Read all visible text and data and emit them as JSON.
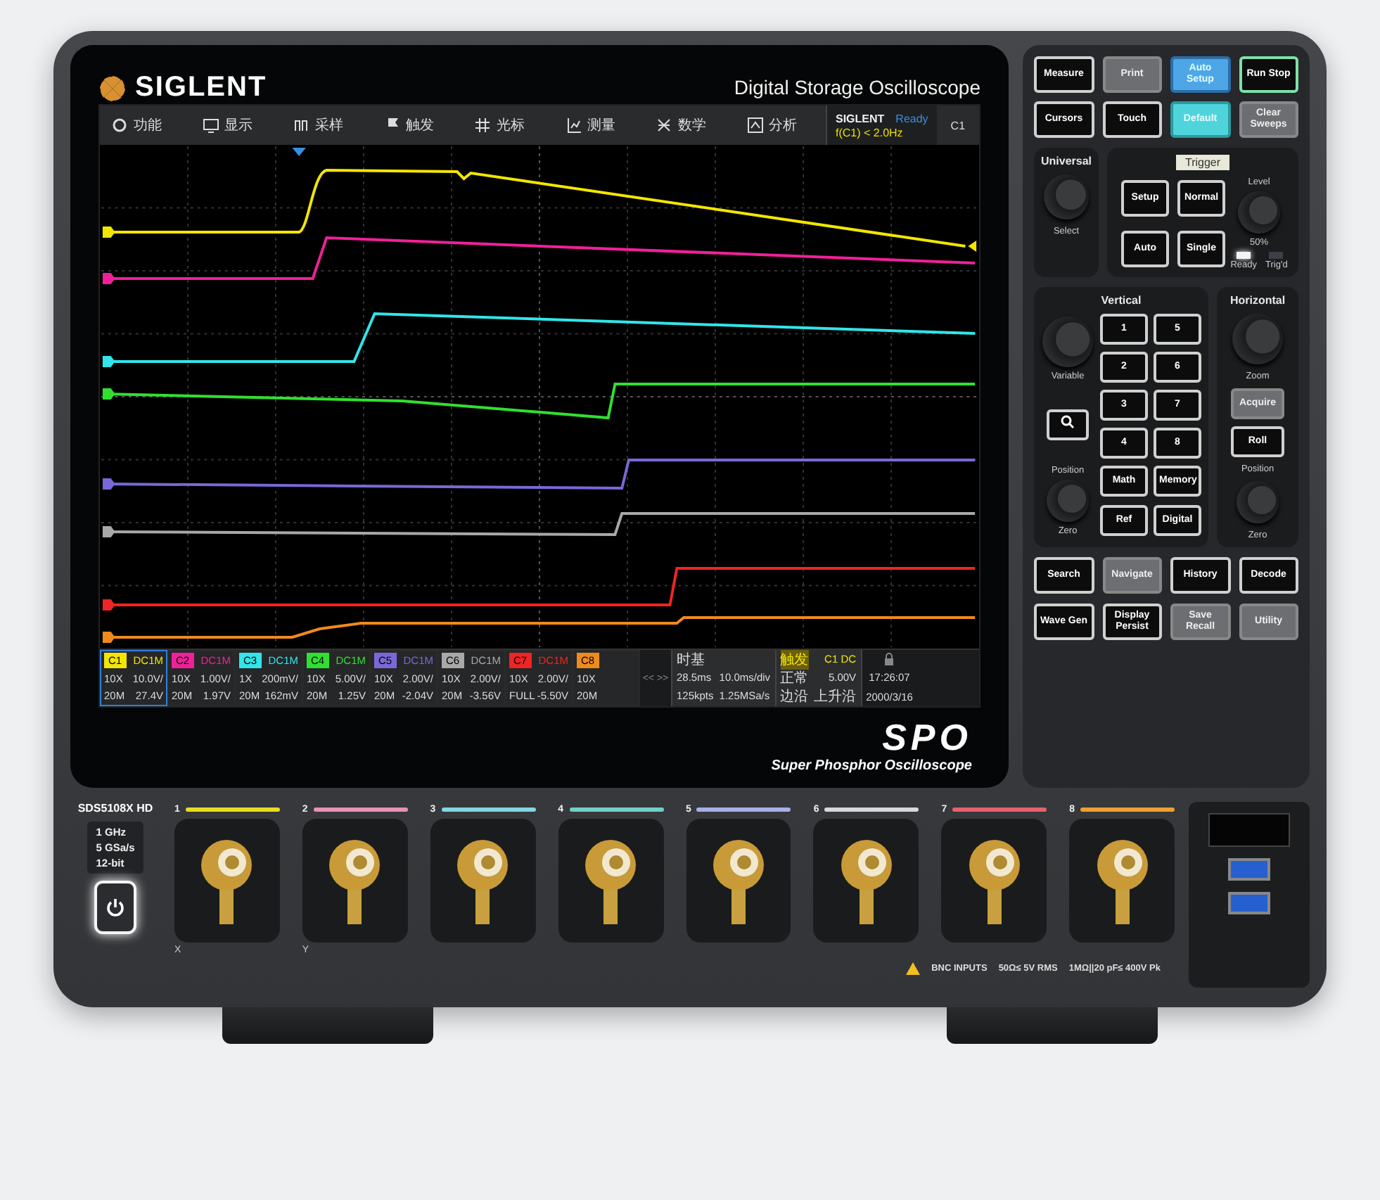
{
  "brand": "SIGLENT",
  "product_title": "Digital Storage Oscilloscope",
  "screen": {
    "menu": [
      {
        "label": "功能"
      },
      {
        "label": "显示"
      },
      {
        "label": "采样"
      },
      {
        "label": "触发"
      },
      {
        "label": "光标"
      },
      {
        "label": "测量"
      },
      {
        "label": "数学"
      },
      {
        "label": "分析"
      }
    ],
    "brand_label": "SIGLENT",
    "status": "Ready",
    "trigger_readout": "f(C1) < 2.0Hz",
    "active_channel": "C1",
    "channels": [
      {
        "label": "C1",
        "color": "#f2e600",
        "coupling": "DC1M",
        "probe": "10X",
        "scale": "10.0V/",
        "bandwidth": "20M",
        "offset": "27.4V",
        "selected": true
      },
      {
        "label": "C2",
        "color": "#f0209a",
        "coupling": "DC1M",
        "probe": "10X",
        "scale": "1.00V/",
        "bandwidth": "20M",
        "offset": "1.97V",
        "selected": false
      },
      {
        "label": "C3",
        "color": "#30e6ea",
        "coupling": "DC1M",
        "probe": "1X",
        "scale": "200mV/",
        "bandwidth": "20M",
        "offset": "162mV",
        "selected": false
      },
      {
        "label": "C4",
        "color": "#30e030",
        "coupling": "DC1M",
        "probe": "10X",
        "scale": "5.00V/",
        "bandwidth": "20M",
        "offset": "1.25V",
        "selected": false
      },
      {
        "label": "C5",
        "color": "#7a68d8",
        "coupling": "DC1M",
        "probe": "10X",
        "scale": "2.00V/",
        "bandwidth": "20M",
        "offset": "-2.04V",
        "selected": false
      },
      {
        "label": "C6",
        "color": "#a8a8a8",
        "coupling": "DC1M",
        "probe": "10X",
        "scale": "2.00V/",
        "bandwidth": "20M",
        "offset": "-3.56V",
        "selected": false
      },
      {
        "label": "C7",
        "color": "#f02424",
        "coupling": "DC1M",
        "probe": "10X",
        "scale": "2.00V/",
        "bandwidth": "FULL",
        "offset": "-5.50V",
        "selected": false
      },
      {
        "label": "C8",
        "color": "#f08a1c",
        "probe": "10X",
        "bandwidth": "20M",
        "selected": false
      }
    ],
    "scroll_arrows": "<< >>",
    "timebase": {
      "title": "时基",
      "delay": "28.5ms",
      "scale": "10.0ms/div",
      "depth": "125kpts",
      "rate": "1.25MSa/s"
    },
    "trigger": {
      "title": "触发",
      "source": "C1 DC",
      "mode": "正常",
      "level": "5.00V",
      "type": "边沿",
      "slope": "上升沿"
    },
    "clock": {
      "time": "17:26:07",
      "date": "2000/3/16"
    }
  },
  "logo": "SPO",
  "tagline": "Super Phosphor Oscilloscope",
  "panel": {
    "top_buttons": [
      {
        "label": "Measure",
        "kind": "dark"
      },
      {
        "label": "Print",
        "kind": "grey"
      },
      {
        "label": "Auto Setup",
        "kind": "blue"
      },
      {
        "label": "Run Stop",
        "kind": "run"
      },
      {
        "label": "Cursors",
        "kind": "dark"
      },
      {
        "label": "Touch",
        "kind": "dark"
      },
      {
        "label": "Default",
        "kind": "cyan"
      },
      {
        "label": "Clear Sweeps",
        "kind": "grey"
      }
    ],
    "universal": {
      "title": "Universal",
      "knob_label": "Select"
    },
    "trigger": {
      "title": "Trigger",
      "buttons": [
        {
          "label": "Setup"
        },
        {
          "label": "Normal"
        },
        {
          "label": "Auto"
        },
        {
          "label": "Single"
        }
      ],
      "knob_label": "Level",
      "hint": "50%",
      "leds": [
        {
          "label": "Ready",
          "on": true
        },
        {
          "label": "Trig'd",
          "on": false
        }
      ]
    },
    "vertical": {
      "title": "Vertical",
      "knob_label": "Variable",
      "channel_buttons": [
        {
          "label": "1"
        },
        {
          "label": "5"
        },
        {
          "label": "2"
        },
        {
          "label": "6"
        },
        {
          "label": "3"
        },
        {
          "label": "7"
        },
        {
          "label": "4"
        },
        {
          "label": "8"
        }
      ],
      "position_label": "Position",
      "zero_label": "Zero",
      "buttons": [
        {
          "label": "Math"
        },
        {
          "label": "Memory"
        },
        {
          "label": "Ref"
        },
        {
          "label": "Digital"
        }
      ]
    },
    "horizontal": {
      "title": "Horizontal",
      "knob_label": "Zoom",
      "buttons": [
        {
          "label": "Acquire",
          "kind": "grey"
        },
        {
          "label": "Roll",
          "kind": "dark"
        }
      ],
      "position_label": "Position",
      "zero_label": "Zero"
    },
    "bottom_buttons": [
      {
        "label": "Search",
        "kind": "dark"
      },
      {
        "label": "Navigate",
        "kind": "grey"
      },
      {
        "label": "History",
        "kind": "dark"
      },
      {
        "label": "Decode",
        "kind": "dark"
      },
      {
        "label": "Wave Gen",
        "kind": "dark"
      },
      {
        "label": "Display Persist",
        "kind": "dark"
      },
      {
        "label": "Save Recall",
        "kind": "grey"
      },
      {
        "label": "Utility",
        "kind": "grey"
      }
    ]
  },
  "front": {
    "model": "SDS5108X HD",
    "specs": [
      "1 GHz",
      "5 GSa/s",
      "12-bit"
    ],
    "inputs": [
      {
        "number": "1",
        "color": "#e8dc20",
        "axis": "X"
      },
      {
        "number": "2",
        "color": "#e890b8",
        "axis": "Y"
      },
      {
        "number": "3",
        "color": "#80d8e0"
      },
      {
        "number": "4",
        "color": "#70d0c8"
      },
      {
        "number": "5",
        "color": "#a8b0e8"
      },
      {
        "number": "6",
        "color": "#d8d8d8"
      },
      {
        "number": "7",
        "color": "#e86070"
      },
      {
        "number": "8",
        "color": "#f0a030"
      }
    ],
    "warning": [
      "BNC INPUTS",
      "50Ω≤ 5V RMS",
      "1MΩ||20 pF≤ 400V Pk"
    ]
  }
}
